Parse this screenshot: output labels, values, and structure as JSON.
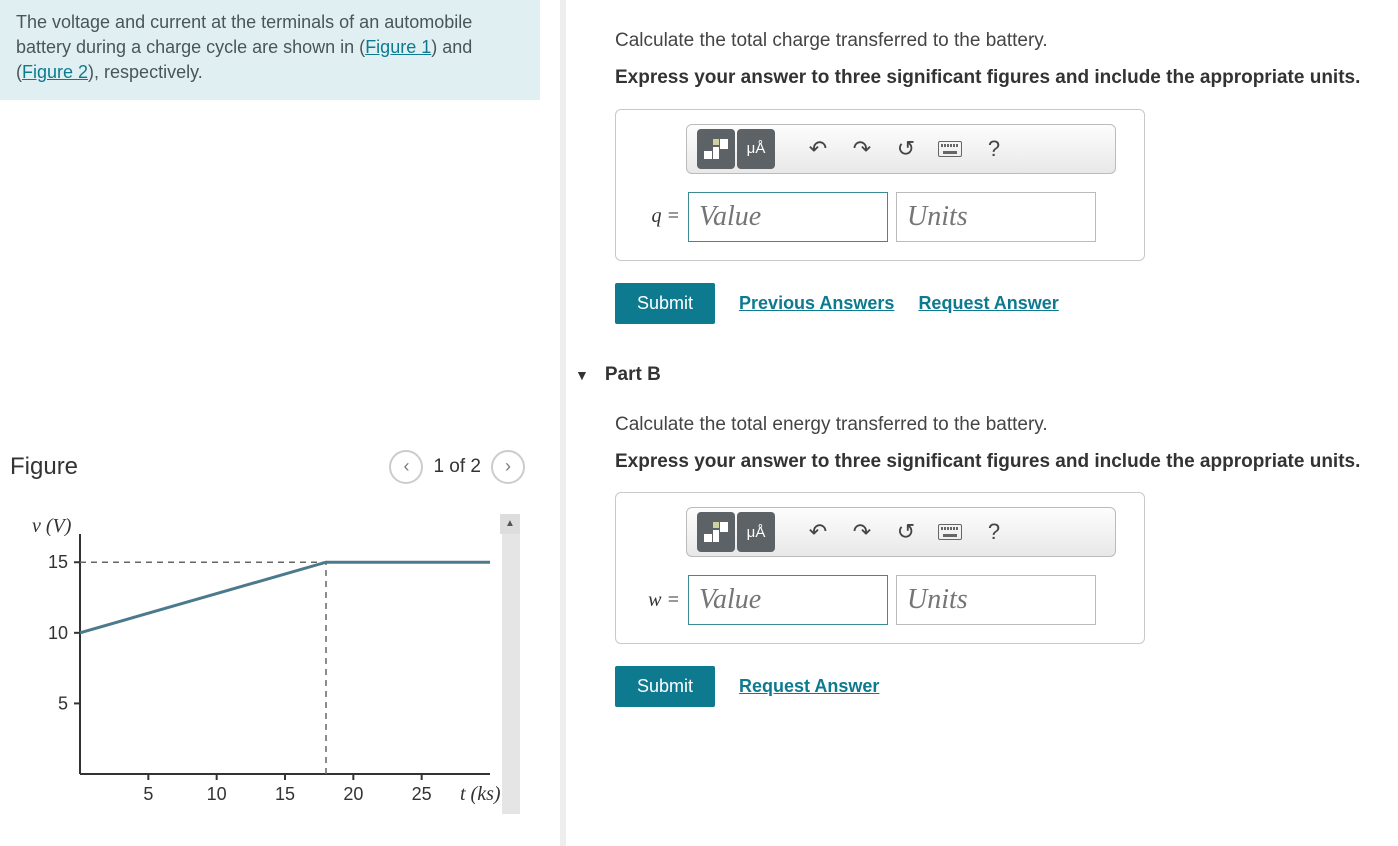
{
  "problem": {
    "text_before": "The voltage and current at the terminals of an automobile battery during a charge cycle are shown in (",
    "fig1": "Figure 1",
    "text_mid": ") and (",
    "fig2": "Figure 2",
    "text_after": "), respectively."
  },
  "figure": {
    "title": "Figure",
    "counter": "1 of 2"
  },
  "chart_data": {
    "type": "line",
    "title": "",
    "ylabel": "v (V)",
    "xlabel": "t (ks)",
    "y_ticks": [
      5,
      10,
      15
    ],
    "x_ticks": [
      5,
      10,
      15,
      20,
      25
    ],
    "ylim": [
      0,
      17
    ],
    "xlim": [
      0,
      30
    ],
    "series": [
      {
        "name": "voltage",
        "points": [
          [
            0,
            10
          ],
          [
            18,
            15
          ],
          [
            30,
            15
          ]
        ]
      }
    ],
    "guides": [
      {
        "type": "hline",
        "y": 15,
        "from_x": 0,
        "to_x": 18
      },
      {
        "type": "vline",
        "x": 18,
        "from_y": 0,
        "to_y": 15
      }
    ]
  },
  "partA": {
    "prompt": "Calculate the total charge transferred to the battery.",
    "instruct": "Express your answer to three significant figures and include the appropriate units.",
    "var": "q =",
    "value_ph": "Value",
    "units_ph": "Units",
    "submit": "Submit",
    "prev": "Previous Answers",
    "req": "Request Answer"
  },
  "partB": {
    "header": "Part B",
    "prompt": "Calculate the total energy transferred to the battery.",
    "instruct": "Express your answer to three significant figures and include the appropriate units.",
    "var": "w =",
    "value_ph": "Value",
    "units_ph": "Units",
    "submit": "Submit",
    "req": "Request Answer"
  },
  "toolbar": {
    "templates_icon": "templates",
    "symbols_icon": "μÅ",
    "help": "?"
  }
}
